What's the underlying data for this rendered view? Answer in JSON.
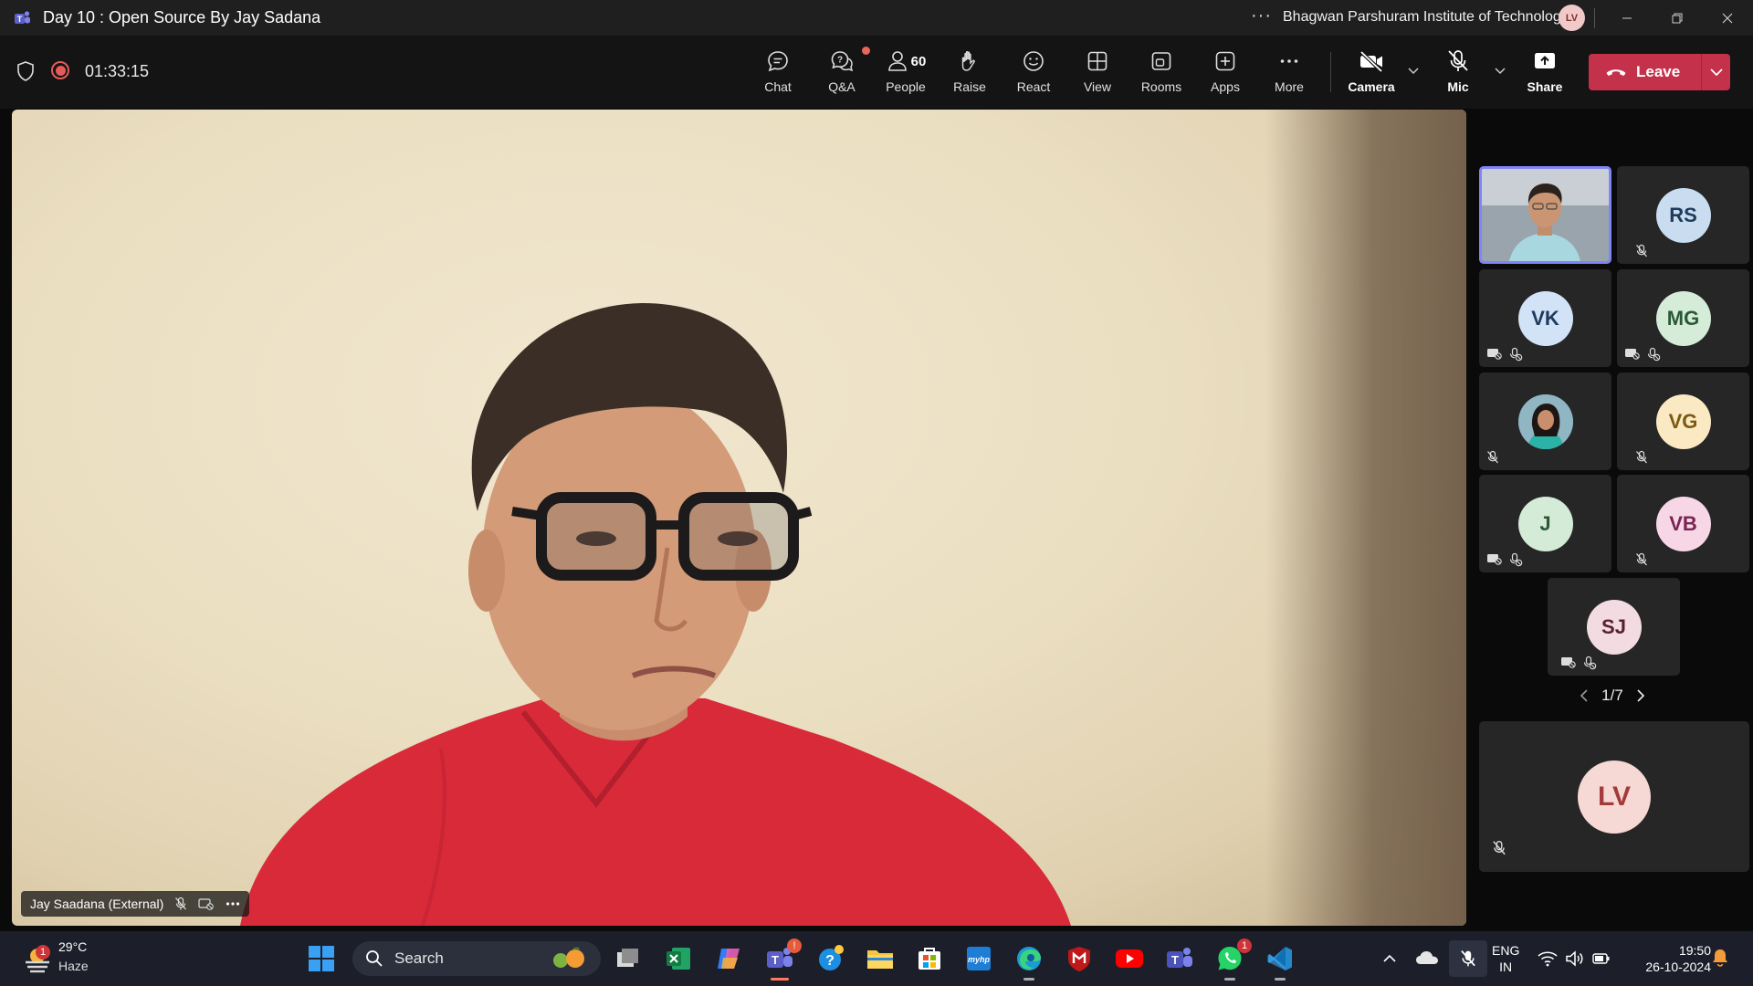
{
  "window": {
    "title": "Day 10 : Open Source By Jay Sadana",
    "organization": "Bhagwan Parshuram Institute of Technology",
    "user_initials": "LV"
  },
  "meeting": {
    "timer": "01:33:15",
    "toolbar": {
      "chat": "Chat",
      "qa": "Q&A",
      "people": "People",
      "people_count": "60",
      "raise": "Raise",
      "react": "React",
      "view": "View",
      "rooms": "Rooms",
      "apps": "Apps",
      "more": "More",
      "camera": "Camera",
      "mic": "Mic",
      "share": "Share",
      "leave": "Leave"
    }
  },
  "stage": {
    "speaker_name": "Jay Saadana (External)"
  },
  "participants": {
    "tiles": [
      {
        "initials": "",
        "type": "video"
      },
      {
        "initials": "RS",
        "bg": "#c9dcf0",
        "fg": "#1f3b5c"
      },
      {
        "initials": "VK",
        "bg": "#d3e3f7",
        "fg": "#1f3b5c"
      },
      {
        "initials": "MG",
        "bg": "#d5ecd9",
        "fg": "#2a5a33"
      },
      {
        "initials": "",
        "type": "photo"
      },
      {
        "initials": "VG",
        "bg": "#fbe9c3",
        "fg": "#7a5a12"
      },
      {
        "initials": "J",
        "bg": "#d4ebd8",
        "fg": "#2a5a33"
      },
      {
        "initials": "VB",
        "bg": "#f7d7e6",
        "fg": "#7a2450"
      },
      {
        "initials": "SJ",
        "bg": "#f3dbe2",
        "fg": "#5b2030"
      }
    ],
    "page": "1/7",
    "self_initials": "LV"
  },
  "taskbar": {
    "weather_temp": "29°C",
    "weather_cond": "Haze",
    "weather_badge": "1",
    "search_label": "Search",
    "teams_badge": "1",
    "whatsapp_badge": "1",
    "lang_line1": "ENG",
    "lang_line2": "IN",
    "time": "19:50",
    "date": "26-10-2024"
  },
  "colors": {
    "leave": "#c4314b",
    "active_tile_border": "#7f85f5",
    "record": "#e45b5b"
  }
}
